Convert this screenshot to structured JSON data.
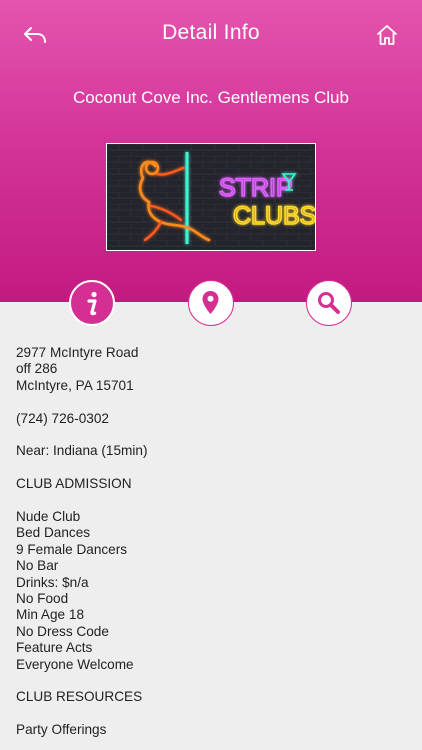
{
  "header": {
    "title": "Detail Info",
    "back_icon": "back-arrow-icon",
    "home_icon": "home-icon",
    "club_name": "Coconut Cove Inc. Gentlemens Club"
  },
  "banner": {
    "line1": "STRIP",
    "line2": "CLUBS"
  },
  "actions": {
    "info_icon": "info-icon",
    "map_icon": "map-pin-icon",
    "search_icon": "search-icon"
  },
  "details": {
    "address": [
      "2977 McIntyre Road",
      "off 286",
      "McIntyre, PA 15701"
    ],
    "phone": "(724) 726-0302",
    "near": "Near: Indiana (15min)",
    "admission_heading": "CLUB ADMISSION",
    "features": [
      "Nude Club",
      "Bed Dances",
      "9 Female Dancers",
      "No Bar",
      "Drinks: $n/a",
      "No Food",
      "Min Age 18",
      "No Dress Code",
      "Feature Acts",
      "Everyone Welcome"
    ],
    "resources_heading": "CLUB RESOURCES",
    "resources": [
      "Party Offerings"
    ]
  },
  "colors": {
    "accent": "#d62f93",
    "header_top": "#e455ae",
    "header_bottom": "#c31a80",
    "background": "#efeeef"
  }
}
